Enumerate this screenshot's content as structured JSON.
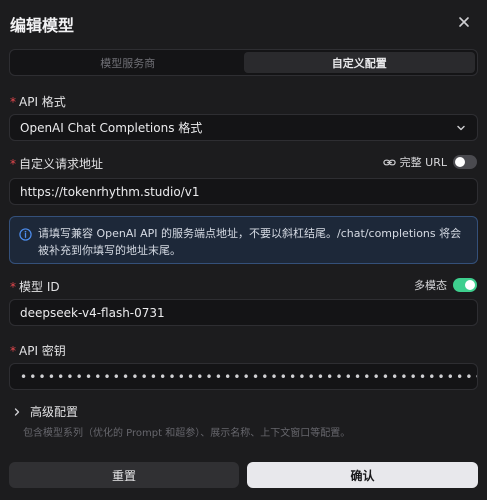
{
  "dialog": {
    "title": "编辑模型",
    "close_icon": "close-icon"
  },
  "tabs": [
    {
      "label": "模型服务商",
      "active": false
    },
    {
      "label": "自定义配置",
      "active": true
    }
  ],
  "api_format": {
    "label": "API 格式",
    "value": "OpenAI Chat Completions 格式",
    "icon": "chevron-down-icon"
  },
  "request_url": {
    "label": "自定义请求地址",
    "value": "https://tokenrhythm.studio/v1",
    "full_url_label": "完整 URL",
    "full_url_enabled": false,
    "link_icon": "link-icon"
  },
  "info": {
    "icon": "info-icon",
    "text": "请填写兼容 OpenAI API 的服务端点地址，不要以斜杠结尾。/chat/completions 将会被补充到你填写的地址末尾。"
  },
  "model_id": {
    "label": "模型 ID",
    "value": "deepseek-v4-flash-0731",
    "multimodal_label": "多模态",
    "multimodal_enabled": true
  },
  "api_key": {
    "label": "API 密钥",
    "masked_value": "••••••••••••••••••••••••••••••••••••••••••••••••••••••••"
  },
  "advanced": {
    "label": "高级配置",
    "description": "包含模型系列（优化的 Prompt 和超参）、展示名称、上下文窗口等配置。",
    "icon": "chevron-right-icon"
  },
  "buttons": {
    "reset": "重置",
    "confirm": "确认"
  },
  "colors": {
    "accent_green": "#3ecf8e",
    "required": "#e5484d",
    "info_bg": "#1d2839",
    "info_border": "#34507a"
  }
}
